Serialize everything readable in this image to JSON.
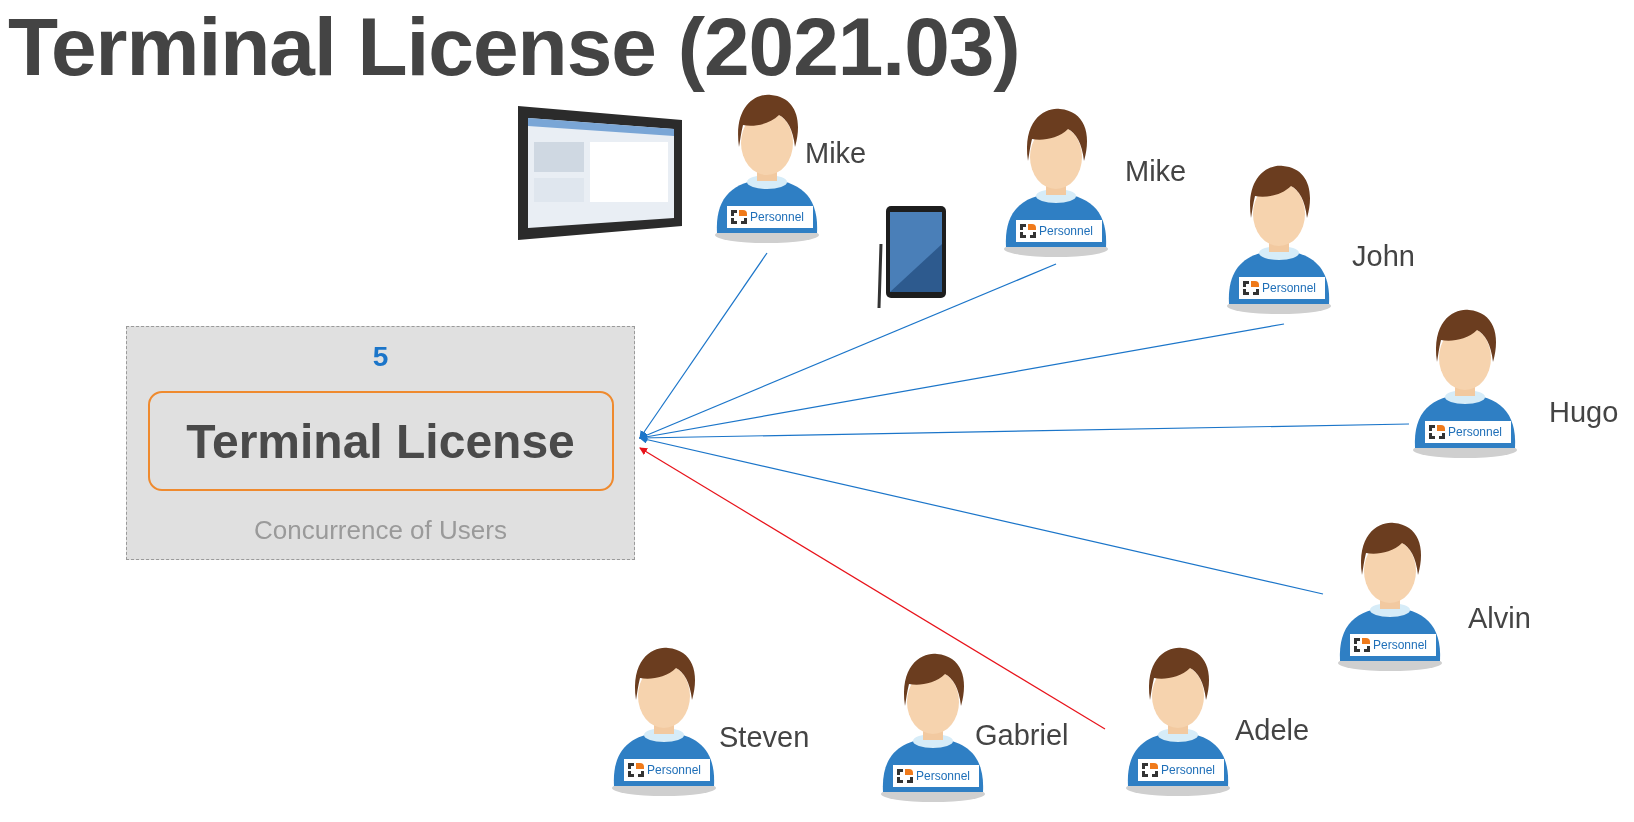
{
  "title": "Terminal License (2021.03)",
  "license": {
    "count": "5",
    "name": "Terminal License",
    "caption": "Concurrence of Users"
  },
  "users": [
    {
      "name": "Mike",
      "badge": "Personnel",
      "color": "#1b75c9"
    },
    {
      "name": "Mike",
      "badge": "Personnel",
      "color": "#1b75c9"
    },
    {
      "name": "John",
      "badge": "Personnel",
      "color": "#1b75c9"
    },
    {
      "name": "Hugo",
      "badge": "Personnel",
      "color": "#1b75c9"
    },
    {
      "name": "Alvin",
      "badge": "Personnel",
      "color": "#1b75c9"
    },
    {
      "name": "Steven",
      "badge": "Personnel"
    },
    {
      "name": "Gabriel",
      "badge": "Personnel"
    },
    {
      "name": "Adele",
      "badge": "Personnel",
      "color": "#e8131b"
    }
  ]
}
